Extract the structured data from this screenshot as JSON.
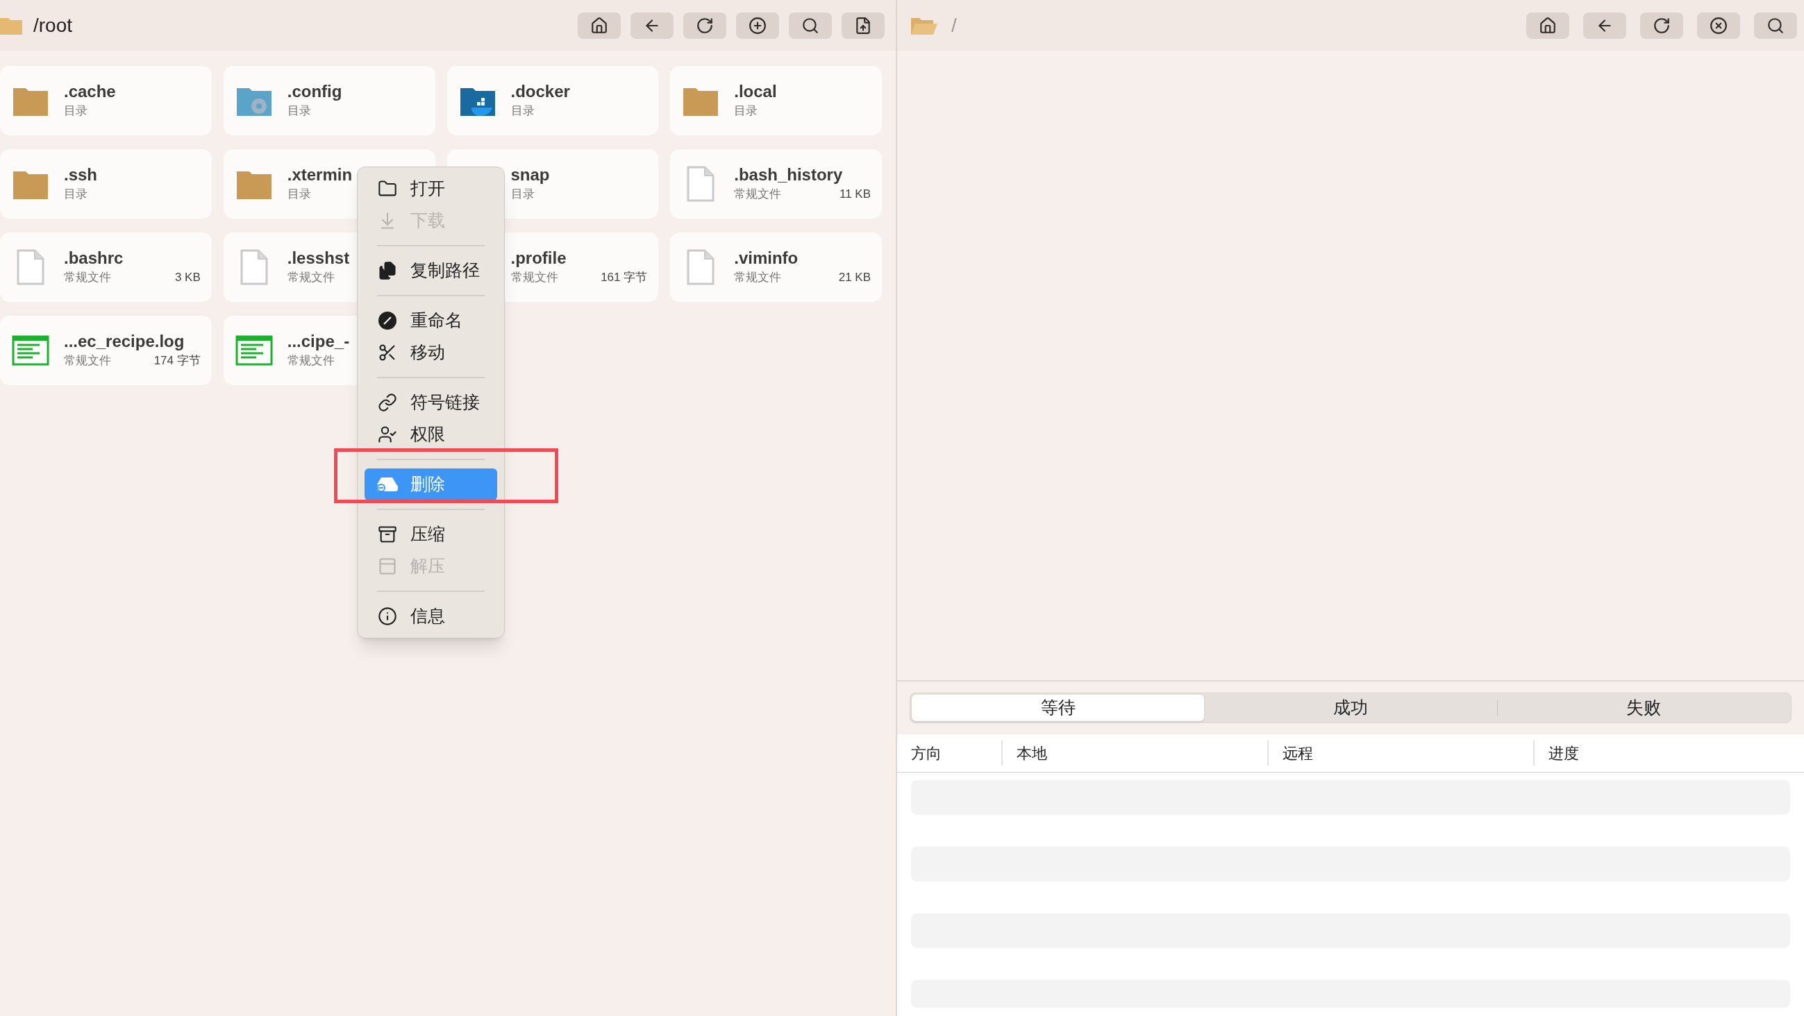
{
  "left_pane": {
    "path": "/root",
    "files": [
      {
        "name": ".cache",
        "type": "目录",
        "kind": "folder"
      },
      {
        "name": ".config",
        "type": "目录",
        "kind": "config-folder"
      },
      {
        "name": ".docker",
        "type": "目录",
        "kind": "docker-folder"
      },
      {
        "name": ".local",
        "type": "目录",
        "kind": "folder"
      },
      {
        "name": ".ssh",
        "type": "目录",
        "kind": "folder"
      },
      {
        "name": ".xtermin",
        "type": "目录",
        "kind": "folder"
      },
      {
        "name": "snap",
        "type": "目录"
      },
      {
        "name": ".bash_history",
        "type": "常规文件",
        "size": "11 KB",
        "kind": "file"
      },
      {
        "name": ".bashrc",
        "type": "常规文件",
        "size": "3 KB",
        "kind": "file"
      },
      {
        "name": ".lesshst",
        "type": "常规文件",
        "kind": "file"
      },
      {
        "name": ".profile",
        "type": "常规文件",
        "size": "161 字节"
      },
      {
        "name": ".viminfo",
        "type": "常规文件",
        "size": "21 KB",
        "kind": "file"
      },
      {
        "name": "...ec_recipe.log",
        "type": "常规文件",
        "size": "174 字节",
        "kind": "log"
      },
      {
        "name": "...cipe_-",
        "type": "常规文件",
        "kind": "log"
      }
    ]
  },
  "context_menu": {
    "items": [
      {
        "kind": "item",
        "label": "打开",
        "disabled": false,
        "selected": false
      },
      {
        "kind": "item",
        "label": "下载",
        "disabled": true,
        "selected": false
      },
      {
        "kind": "separator"
      },
      {
        "kind": "item",
        "label": "复制路径",
        "disabled": false,
        "selected": false
      },
      {
        "kind": "separator"
      },
      {
        "kind": "item",
        "label": "重命名",
        "disabled": false,
        "selected": false
      },
      {
        "kind": "item",
        "label": "移动",
        "disabled": false,
        "selected": false
      },
      {
        "kind": "separator"
      },
      {
        "kind": "item",
        "label": "符号链接",
        "disabled": false,
        "selected": false
      },
      {
        "kind": "item",
        "label": "权限",
        "disabled": false,
        "selected": false
      },
      {
        "kind": "separator"
      },
      {
        "kind": "item",
        "label": "删除",
        "disabled": false,
        "selected": true
      },
      {
        "kind": "separator"
      },
      {
        "kind": "item",
        "label": "压缩",
        "disabled": false,
        "selected": false
      },
      {
        "kind": "item",
        "label": "解压",
        "disabled": true,
        "selected": false
      },
      {
        "kind": "separator"
      },
      {
        "kind": "item",
        "label": "信息",
        "disabled": false,
        "selected": false
      }
    ]
  },
  "right_pane": {
    "path": "/"
  },
  "transfers": {
    "tabs": [
      {
        "label": "等待",
        "selected": true
      },
      {
        "label": "成功",
        "selected": false
      },
      {
        "label": "失败",
        "selected": false
      }
    ],
    "columns": [
      "方向",
      "本地",
      "远程",
      "进度"
    ]
  }
}
